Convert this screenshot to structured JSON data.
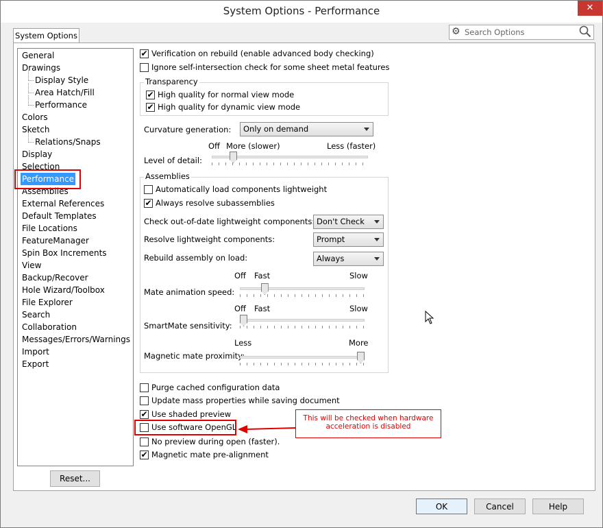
{
  "window": {
    "title": "System Options - Performance",
    "close": "✕"
  },
  "tab": {
    "label": "System Options"
  },
  "search": {
    "placeholder": "Search Options"
  },
  "tree": {
    "items": [
      {
        "label": "General",
        "indent": 0
      },
      {
        "label": "Drawings",
        "indent": 0
      },
      {
        "label": "Display Style",
        "indent": 1
      },
      {
        "label": "Area Hatch/Fill",
        "indent": 1
      },
      {
        "label": "Performance",
        "indent": 1
      },
      {
        "label": "Colors",
        "indent": 0
      },
      {
        "label": "Sketch",
        "indent": 0
      },
      {
        "label": "Relations/Snaps",
        "indent": 1
      },
      {
        "label": "Display",
        "indent": 0
      },
      {
        "label": "Selection",
        "indent": 0
      },
      {
        "label": "Performance",
        "indent": 0,
        "selected": true
      },
      {
        "label": "Assemblies",
        "indent": 0
      },
      {
        "label": "External References",
        "indent": 0
      },
      {
        "label": "Default Templates",
        "indent": 0
      },
      {
        "label": "File Locations",
        "indent": 0
      },
      {
        "label": "FeatureManager",
        "indent": 0
      },
      {
        "label": "Spin Box Increments",
        "indent": 0
      },
      {
        "label": "View",
        "indent": 0
      },
      {
        "label": "Backup/Recover",
        "indent": 0
      },
      {
        "label": "Hole Wizard/Toolbox",
        "indent": 0
      },
      {
        "label": "File Explorer",
        "indent": 0
      },
      {
        "label": "Search",
        "indent": 0
      },
      {
        "label": "Collaboration",
        "indent": 0
      },
      {
        "label": "Messages/Errors/Warnings",
        "indent": 0
      },
      {
        "label": "Import",
        "indent": 0
      },
      {
        "label": "Export",
        "indent": 0
      }
    ]
  },
  "reset_label": "Reset...",
  "checkmark": "✔",
  "options": {
    "verification": {
      "label": "Verification on rebuild (enable advanced body checking)",
      "checked": true
    },
    "ignore_self": {
      "label": "Ignore self-intersection check for some sheet metal features",
      "checked": false
    },
    "purge": {
      "label": "Purge cached configuration data",
      "checked": false
    },
    "mass": {
      "label": "Update mass properties while saving document",
      "checked": false
    },
    "shaded": {
      "label": "Use shaded preview",
      "checked": true
    },
    "opengl": {
      "label": "Use software OpenGL",
      "checked": false
    },
    "no_preview": {
      "label": "No preview during open (faster).",
      "checked": false
    },
    "pre_align": {
      "label": "Magnetic mate pre-alignment",
      "checked": true
    }
  },
  "transparency": {
    "title": "Transparency",
    "normal": {
      "label": "High quality for normal view mode",
      "checked": true
    },
    "dynamic": {
      "label": "High quality for dynamic view mode",
      "checked": true
    }
  },
  "curvature": {
    "label": "Curvature generation:",
    "value": "Only on demand"
  },
  "level_of_detail": {
    "label": "Level of detail:",
    "off": "Off",
    "left": "More (slower)",
    "right": "Less (faster)",
    "level": 0.12
  },
  "assemblies": {
    "title": "Assemblies",
    "auto_light": {
      "label": "Automatically load components lightweight",
      "checked": false
    },
    "always_resolve": {
      "label": "Always resolve subassemblies",
      "checked": true
    },
    "check_outdated": {
      "label": "Check out-of-date lightweight components:",
      "value": "Don't Check"
    },
    "resolve_light": {
      "label": "Resolve lightweight components:",
      "value": "Prompt"
    },
    "rebuild": {
      "label": "Rebuild assembly on load:",
      "value": "Always"
    },
    "mate_anim": {
      "label": "Mate animation speed:",
      "off": "Off",
      "left": "Fast",
      "right": "Slow",
      "level": 0.18
    },
    "smartmate": {
      "label": "SmartMate sensitivity:",
      "off": "Off",
      "left": "Fast",
      "right": "Slow",
      "level": 0.0
    },
    "magnetic": {
      "label": "Magnetic mate proximity:",
      "left": "Less",
      "right": "More",
      "level": 1.0
    }
  },
  "callout": {
    "text": "This will be checked when hardware acceleration is disabled"
  },
  "buttons": {
    "ok": "OK",
    "cancel": "Cancel",
    "help": "Help"
  }
}
